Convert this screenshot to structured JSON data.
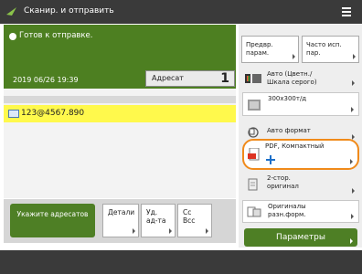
{
  "header": {
    "title": "Сканир. и отправить"
  },
  "status": {
    "ready_text": "Готов к отправке.",
    "datetime": "2019 06/26 19:39",
    "destination_label": "Адресат",
    "destination_count": "1"
  },
  "recipients": [
    {
      "address": "123@4567.890"
    }
  ],
  "bottom_buttons": {
    "specify": "Укажите адресатов",
    "details": "Детали",
    "delete": "Уд. ад-та",
    "cc_bcc": "Cc Bcc"
  },
  "right_panel": {
    "tabs": [
      {
        "label": "Предвр. парам."
      },
      {
        "label": "Часто исп. пар."
      }
    ],
    "items": [
      {
        "label": "Авто (Цветн./ Шкала серого)",
        "icon": "color-mode-icon"
      },
      {
        "label": "300x300т/д",
        "icon": "resolution-icon"
      },
      {
        "label": "Авто формат",
        "icon": "auto-size-icon"
      },
      {
        "label": "PDF, Компактный",
        "icon": "pdf-file-icon"
      },
      {
        "label": "2-стор. оригинал",
        "icon": "two-sided-original-icon"
      },
      {
        "label": "Оригиналы разн.форм.",
        "icon": "mixed-originals-icon"
      }
    ],
    "params_label": "Параметры"
  },
  "colors": {
    "accent": "#4e7f25",
    "highlight": "#fff94c",
    "ring": "#f08a1a"
  }
}
